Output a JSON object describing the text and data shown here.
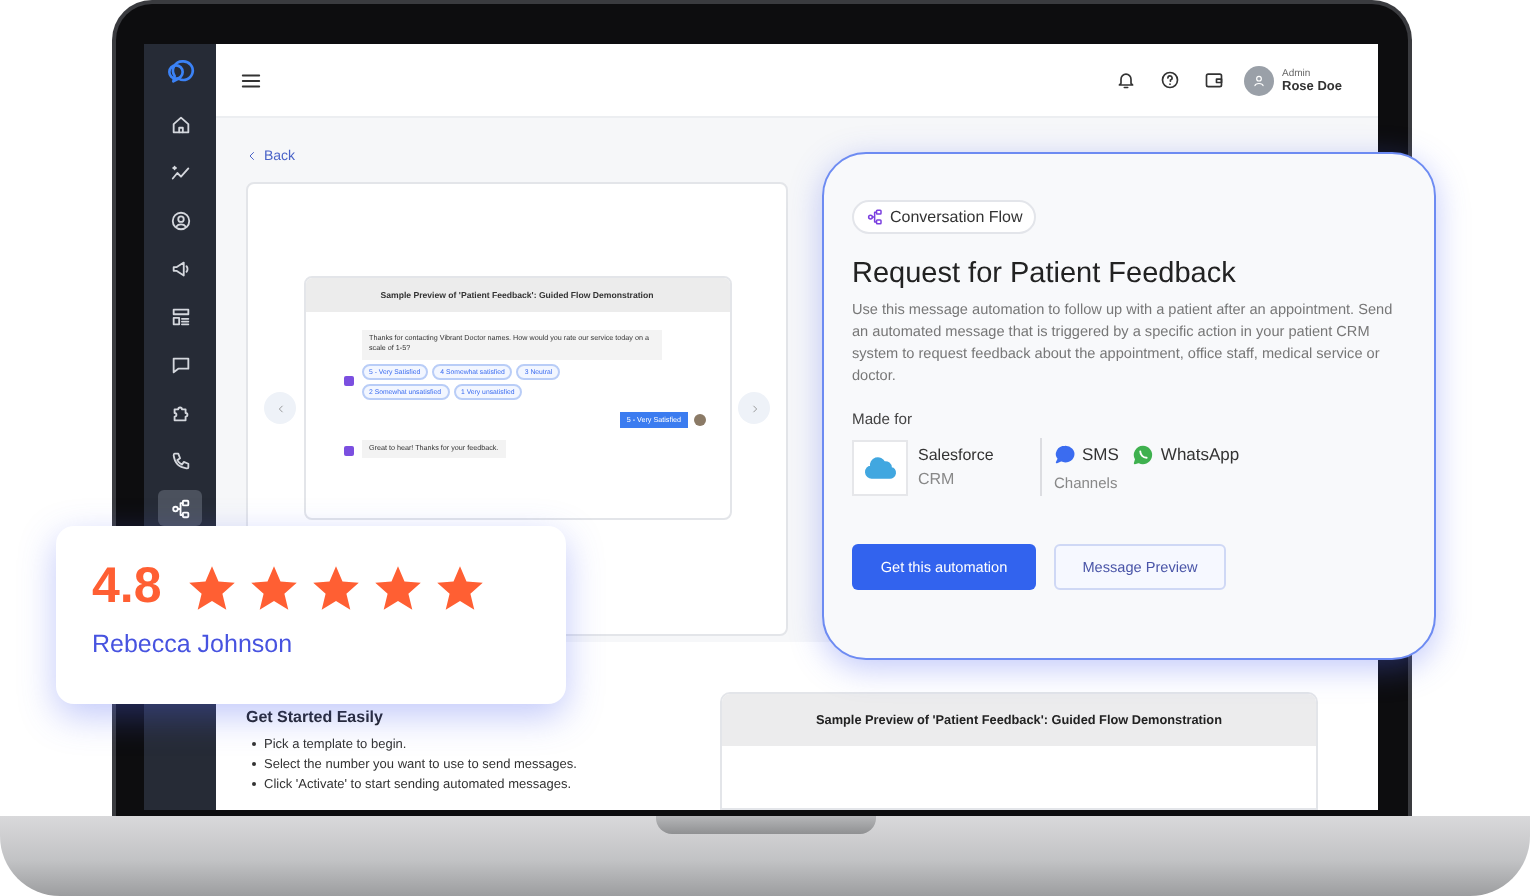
{
  "sidebar": {
    "items": [
      {
        "selected": false
      },
      {
        "selected": false
      },
      {
        "selected": false
      },
      {
        "selected": false
      },
      {
        "selected": false
      },
      {
        "selected": false
      },
      {
        "selected": false
      },
      {
        "selected": false
      },
      {
        "selected": true
      }
    ]
  },
  "header": {
    "user": {
      "role": "Admin",
      "name": "Rose Doe"
    }
  },
  "back_link": "Back",
  "preview": {
    "title": "Sample Preview of 'Patient Feedback': Guided Flow Demonstration",
    "messages": [
      {
        "kind": "bot",
        "text": "Thanks for contacting Vibrant Doctor names. How would you rate our service today on a scale of 1-5?",
        "options": [
          "5 - Very Satisfied",
          "4 Somewhat satisfied",
          "3 Neutral",
          "2 Somewhat unsatisfied",
          "1 Very unsatisfied"
        ]
      },
      {
        "kind": "user",
        "text": "5 - Very Satisfied"
      },
      {
        "kind": "bot",
        "text": "Great to hear! Thanks for your feedback."
      }
    ]
  },
  "get_started": {
    "title": "Get Started Easily",
    "steps": [
      "Pick a template to begin.",
      "Select the number you want to use to send messages.",
      "Click 'Activate' to start sending automated messages."
    ]
  },
  "preview_2": {
    "title": "Sample Preview of 'Patient Feedback': Guided Flow Demonstration"
  },
  "rating": {
    "value": "4.8",
    "stars": 5,
    "name": "Rebecca Johnson"
  },
  "automation": {
    "tag": "Conversation Flow",
    "title": "Request for Patient Feedback",
    "description": "Use this message automation to follow up with a patient after an appointment. Send an automated message that is triggered by a specific action in your patient CRM system to request feedback about the appointment, office staff, medical service or doctor.",
    "made_for_label": "Made for",
    "integration": {
      "name": "Salesforce",
      "type": "CRM"
    },
    "channels": [
      {
        "name": "SMS"
      },
      {
        "name": "WhatsApp"
      }
    ],
    "channels_label": "Channels",
    "buttons": [
      {
        "label": "Get this automation",
        "kind": "primary"
      },
      {
        "label": "Message Preview",
        "kind": "secondary"
      }
    ]
  }
}
